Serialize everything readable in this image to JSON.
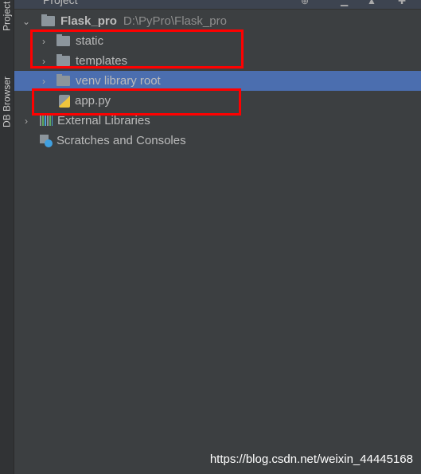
{
  "side_tabs": [
    "Project",
    "DB Browser"
  ],
  "header": {
    "title": "Project"
  },
  "tree": [
    {
      "label": "Flask_pro",
      "path": "D:\\PyPro\\Flask_pro",
      "type": "project",
      "expanded": true
    },
    {
      "label": "static",
      "type": "folder"
    },
    {
      "label": "templates",
      "type": "folder"
    },
    {
      "label": "venv",
      "suffix": "library root",
      "type": "folder",
      "selected": true
    },
    {
      "label": "app.py",
      "type": "python-file"
    },
    {
      "label": "External Libraries",
      "type": "libraries"
    },
    {
      "label": "Scratches and Consoles",
      "type": "scratches"
    }
  ],
  "watermark": "https://blog.csdn.net/weixin_44445168",
  "colors": {
    "selection": "#4b6eaf",
    "highlight_box": "#ff0000"
  }
}
